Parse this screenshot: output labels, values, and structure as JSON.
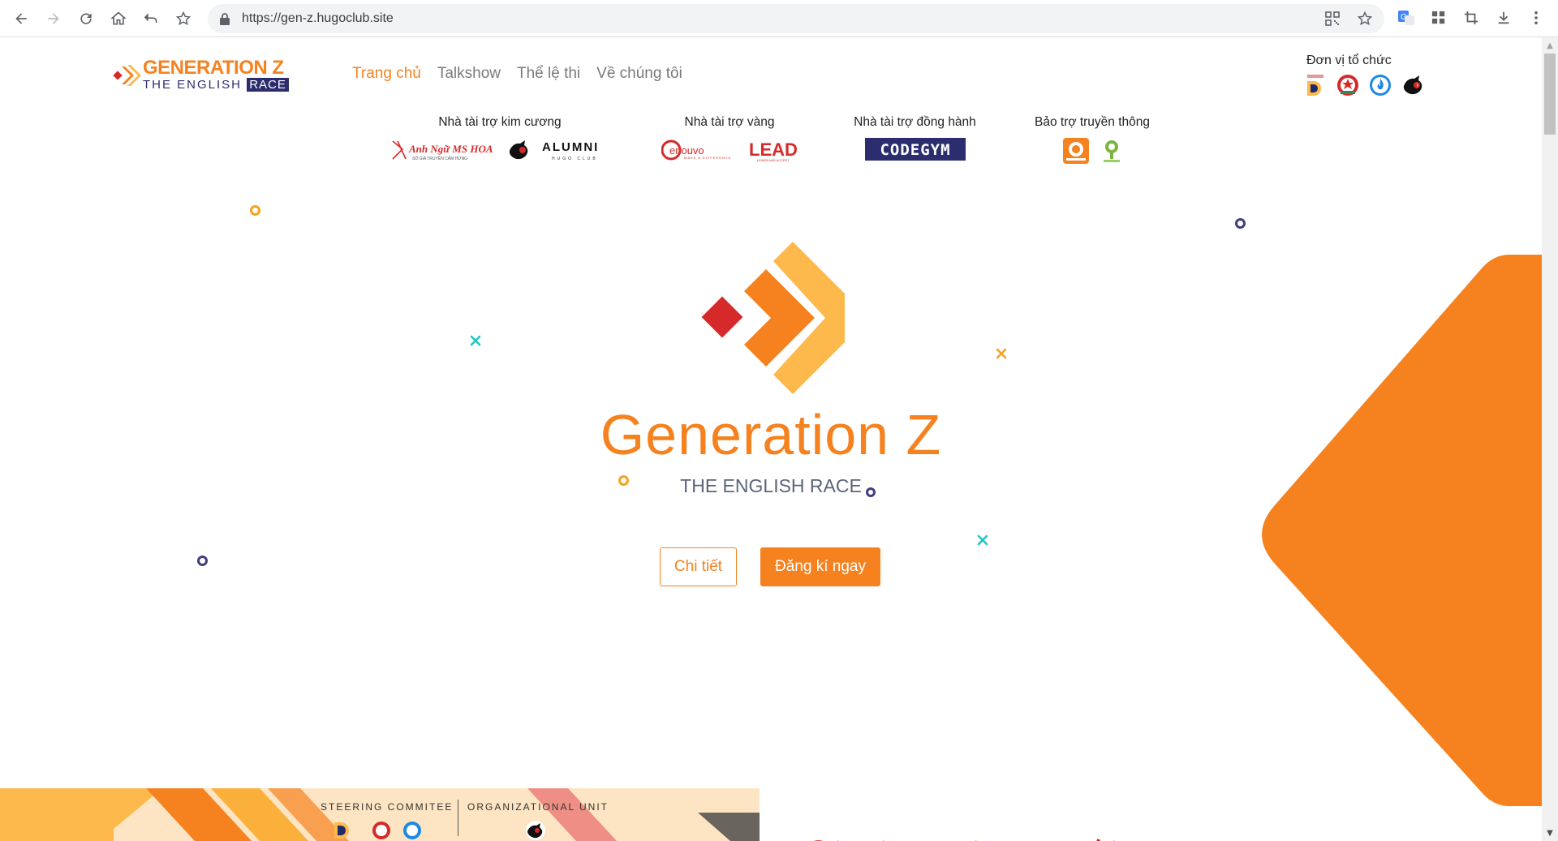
{
  "browser": {
    "url": "https://gen-z.hugoclub.site"
  },
  "site": {
    "logo": {
      "line1": "GENERATION Z",
      "line2_prefix": "THE ENGLISH ",
      "line2_box": "RACE"
    },
    "nav": [
      {
        "label": "Trang chủ",
        "active": true
      },
      {
        "label": "Talkshow",
        "active": false
      },
      {
        "label": "Thể lệ thi",
        "active": false
      },
      {
        "label": "Về chúng tôi",
        "active": false
      }
    ],
    "organizer_title": "Đơn vị tổ chức",
    "sponsors": [
      {
        "label": "Nhà tài trợ kim cương",
        "logos": [
          "Anh Ngữ MS HOA",
          "ALUMNI"
        ]
      },
      {
        "label": "Nhà tài trợ vàng",
        "logos": [
          "enouvo",
          "LEAD"
        ]
      },
      {
        "label": "Nhà tài trợ đồng hành",
        "logos": [
          "CODEGYM"
        ]
      },
      {
        "label": "Bảo trợ truyền thông",
        "logos": []
      }
    ]
  },
  "hero": {
    "title": "Generation Z",
    "subtitle": "THE ENGLISH RACE",
    "detail_button": "Chi tiết",
    "register_button": "Đăng kí ngay"
  },
  "banner": {
    "left_text": "STEERING COMMITEE",
    "right_text": "ORGANIZATIONAL UNIT"
  },
  "colors": {
    "brand_orange": "#f5821f",
    "brand_yellow": "#fdb94b",
    "brand_red": "#d62a2a",
    "navy": "#2b2d6e",
    "teal": "#20c5c5"
  }
}
